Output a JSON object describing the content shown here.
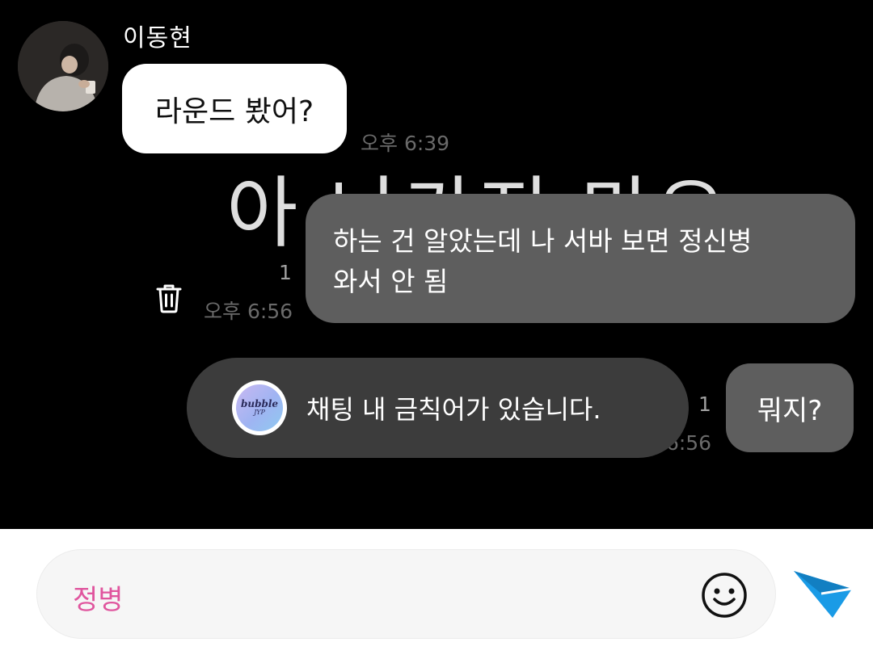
{
  "conversation": {
    "sender_name": "이동현",
    "incoming_message": "라운드 봤어?",
    "incoming_time": "오후 6:39",
    "background_text": "아 나가지 마요",
    "outgoing_1": {
      "line1": "하는 건 알았는데 나 서바 보면 정신병",
      "line2": "와서 안 됨",
      "read_count": "1",
      "time": "오후 6:56"
    },
    "outgoing_2": {
      "text": "뭐지?",
      "read_count": "1",
      "time": "오후 6:56"
    }
  },
  "toast": {
    "logo_text": "bubble",
    "logo_sub": "JYP",
    "message": "채팅 내 금칙어가 있습니다."
  },
  "composer": {
    "input_value": "정병",
    "input_color": "#e0559e",
    "emoji_icon": "smiley-icon",
    "send_icon": "paper-plane-icon",
    "send_color": "#1a9be6"
  }
}
